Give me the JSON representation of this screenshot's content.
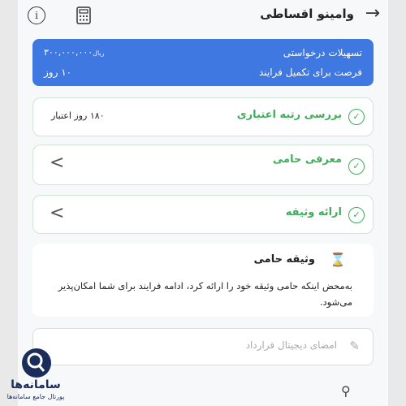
{
  "header": {
    "title": "وامینو اقساطی",
    "back_icon": "arrow-right-icon",
    "info_icon": "info-icon",
    "calculator_icon": "calculator-icon"
  },
  "summary": {
    "requested_label": "تسهیلات درخواستی",
    "requested_amount": "۳۰۰,۰۰۰,۰۰۰",
    "currency": "ریال",
    "deadline_label": "فرصت برای تکمیل فرایند",
    "deadline_value": "۱۰ روز"
  },
  "steps": [
    {
      "label": "بررسی رتبه اعتباری",
      "info": "۱۸۰ روز اعتبار",
      "status": "done"
    },
    {
      "label": "معرفی حامی",
      "status": "done"
    },
    {
      "label": "ارائه وثیقه",
      "status": "done"
    }
  ],
  "bond_card": {
    "title": "وثیقه حامی",
    "text": "به‌محض اینکه حامی وثیقه خود را ارائه کرد، ادامه فرایند برای شما امکان‌پذیر می‌شود."
  },
  "sign_step": {
    "label": "امضای دیجیتال قرارداد"
  },
  "watermark": {
    "name": "سامانه‌ها",
    "tagline": "پورتال جامع سامانه‌ها"
  },
  "colors": {
    "accent": "#3f78e0",
    "success": "#3fae5a"
  }
}
